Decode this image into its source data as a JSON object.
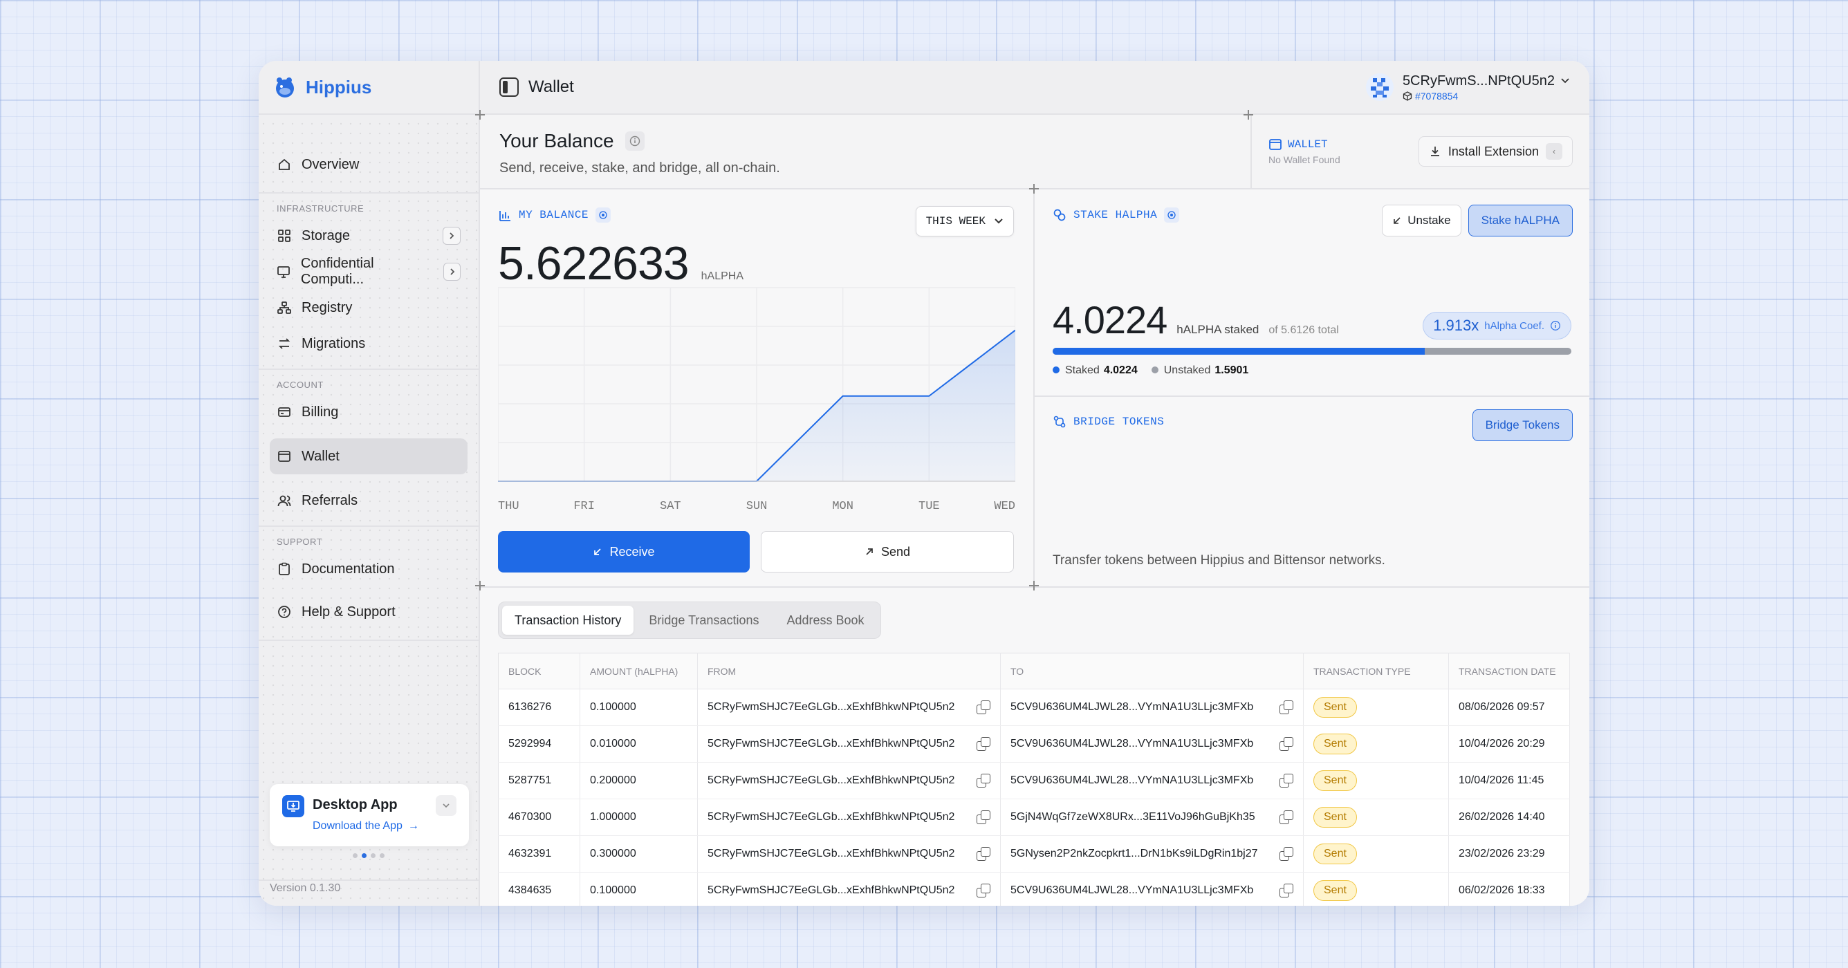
{
  "app": {
    "name": "Hippius",
    "page_title": "Wallet",
    "version": "Version 0.1.30"
  },
  "account": {
    "address": "5CRyFwmS...NPtQU5n2",
    "id": "#7078854"
  },
  "sidebar": {
    "items_top": [
      {
        "label": "Overview",
        "icon": "home-icon"
      }
    ],
    "infrastructure_label": "INFRASTRUCTURE",
    "infrastructure": [
      {
        "label": "Storage",
        "icon": "grid-icon",
        "expandable": true
      },
      {
        "label": "Confidential Computi...",
        "icon": "monitor-icon",
        "expandable": true
      },
      {
        "label": "Registry",
        "icon": "network-icon"
      },
      {
        "label": "Migrations",
        "icon": "swap-icon"
      }
    ],
    "account_label": "ACCOUNT",
    "account": [
      {
        "label": "Billing",
        "icon": "card-icon"
      },
      {
        "label": "Wallet",
        "icon": "wallet-icon",
        "active": true
      },
      {
        "label": "Referrals",
        "icon": "users-icon"
      }
    ],
    "support_label": "SUPPORT",
    "support": [
      {
        "label": "Documentation",
        "icon": "clipboard-icon"
      },
      {
        "label": "Help & Support",
        "icon": "help-icon"
      }
    ],
    "desktop_card": {
      "title": "Desktop App",
      "link": "Download the App"
    }
  },
  "header": {
    "title": "Your Balance",
    "subtitle": "Send, receive, stake, and bridge, all on-chain.",
    "wallet_label": "WALLET",
    "wallet_status": "No Wallet Found",
    "install_button": "Install Extension"
  },
  "balance": {
    "label": "MY BALANCE",
    "value": "5.622633",
    "unit": "hALPHA",
    "range_select": "THIS WEEK",
    "receive_label": "Receive",
    "send_label": "Send"
  },
  "chart_data": {
    "type": "area",
    "categories": [
      "THU",
      "FRI",
      "SAT",
      "SUN",
      "MON",
      "TUE",
      "WED"
    ],
    "series": [
      {
        "values": [
          0,
          0,
          0,
          0,
          2.2,
          2.2,
          3.9
        ]
      }
    ],
    "ylim": [
      0,
      5
    ],
    "grid": true,
    "color": "#1f6ae6"
  },
  "stake": {
    "label": "STAKE HALPHA",
    "unstake_label": "Unstake",
    "stake_label": "Stake hALPHA",
    "value": "4.0224",
    "unit": "hALPHA staked",
    "of_total": "of 5.6126 total",
    "coef_value": "1.913x",
    "coef_label": "hAlpha Coef.",
    "staked_fraction": 0.717,
    "legend_staked_label": "Staked",
    "legend_staked_value": "4.0224",
    "legend_unstaked_label": "Unstaked",
    "legend_unstaked_value": "1.5901"
  },
  "bridge": {
    "label": "BRIDGE TOKENS",
    "button": "Bridge Tokens",
    "description": "Transfer tokens between Hippius and Bittensor networks."
  },
  "tabs": [
    "Transaction History",
    "Bridge Transactions",
    "Address Book"
  ],
  "table": {
    "headers": [
      "BLOCK",
      "AMOUNT (hALPHA)",
      "FROM",
      "TO",
      "TRANSACTION TYPE",
      "TRANSACTION DATE"
    ],
    "rows": [
      {
        "block": "6136276",
        "amount": "0.100000",
        "from": "5CRyFwmSHJC7EeGLGb...xExhfBhkwNPtQU5n2",
        "to": "5CV9U636UM4LJWL28...VYmNA1U3LLjc3MFXb",
        "type": "Sent",
        "date": "08/06/2026 09:57"
      },
      {
        "block": "5292994",
        "amount": "0.010000",
        "from": "5CRyFwmSHJC7EeGLGb...xExhfBhkwNPtQU5n2",
        "to": "5CV9U636UM4LJWL28...VYmNA1U3LLjc3MFXb",
        "type": "Sent",
        "date": "10/04/2026 20:29"
      },
      {
        "block": "5287751",
        "amount": "0.200000",
        "from": "5CRyFwmSHJC7EeGLGb...xExhfBhkwNPtQU5n2",
        "to": "5CV9U636UM4LJWL28...VYmNA1U3LLjc3MFXb",
        "type": "Sent",
        "date": "10/04/2026 11:45"
      },
      {
        "block": "4670300",
        "amount": "1.000000",
        "from": "5CRyFwmSHJC7EeGLGb...xExhfBhkwNPtQU5n2",
        "to": "5GjN4WqGf7zeWX8URx...3E11VoJ96hGuBjKh35",
        "type": "Sent",
        "date": "26/02/2026 14:40"
      },
      {
        "block": "4632391",
        "amount": "0.300000",
        "from": "5CRyFwmSHJC7EeGLGb...xExhfBhkwNPtQU5n2",
        "to": "5GNysen2P2nkZocpkrt1...DrN1bKs9iLDgRin1bj27",
        "type": "Sent",
        "date": "23/02/2026 23:29"
      },
      {
        "block": "4384635",
        "amount": "0.100000",
        "from": "5CRyFwmSHJC7EeGLGb...xExhfBhkwNPtQU5n2",
        "to": "5CV9U636UM4LJWL28...VYmNA1U3LLjc3MFXb",
        "type": "Sent",
        "date": "06/02/2026 18:33"
      }
    ]
  }
}
